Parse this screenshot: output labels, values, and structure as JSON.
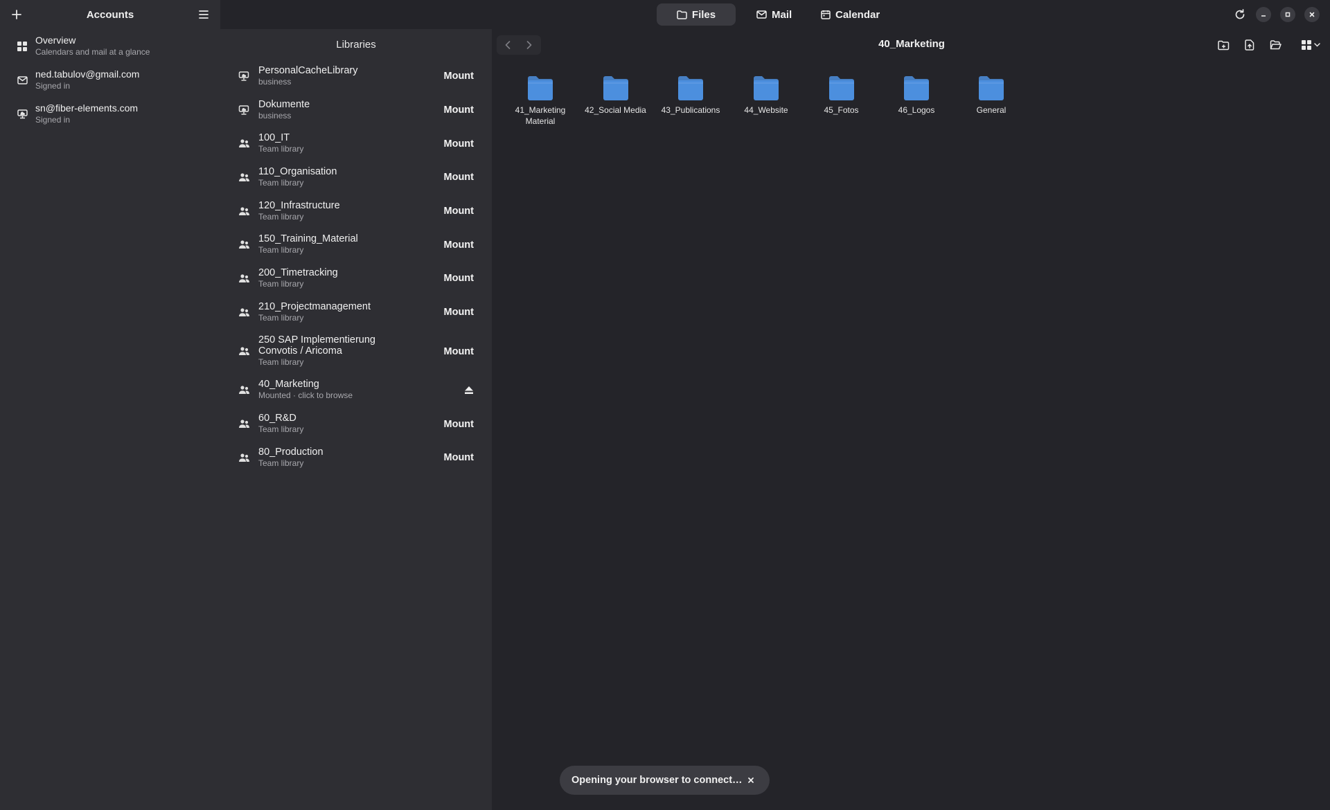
{
  "sidebar": {
    "title": "Accounts",
    "add_icon": "plus-icon",
    "menu_icon": "hamburger-menu-icon",
    "items": [
      {
        "name": "Overview",
        "sub": "Calendars and mail at a glance",
        "icon": "grid-icon"
      },
      {
        "name": "ned.tabulov@gmail.com",
        "sub": "Signed in",
        "icon": "mail-icon"
      },
      {
        "name": "sn@fiber-elements.com",
        "sub": "Signed in",
        "icon": "cloud-drive-icon"
      }
    ]
  },
  "topbar": {
    "tabs": [
      {
        "label": "Files",
        "icon": "folder-icon",
        "active": true
      },
      {
        "label": "Mail",
        "icon": "mail-icon",
        "active": false
      },
      {
        "label": "Calendar",
        "icon": "calendar-icon",
        "active": false
      }
    ],
    "window_controls": [
      "refresh-icon",
      "minimize-icon",
      "maximize-icon",
      "close-icon"
    ]
  },
  "libraries": {
    "title": "Libraries",
    "mount_label": "Mount",
    "items": [
      {
        "name": "PersonalCacheLibrary",
        "sub": "business",
        "type": "personal"
      },
      {
        "name": "Dokumente",
        "sub": "business",
        "type": "personal"
      },
      {
        "name": "100_IT",
        "sub": "Team library",
        "type": "team"
      },
      {
        "name": "110_Organisation",
        "sub": "Team library",
        "type": "team"
      },
      {
        "name": "120_Infrastructure",
        "sub": "Team library",
        "type": "team"
      },
      {
        "name": "150_Training_Material",
        "sub": "Team library",
        "type": "team"
      },
      {
        "name": "200_Timetracking",
        "sub": "Team library",
        "type": "team"
      },
      {
        "name": "210_Projectmanagement",
        "sub": "Team library",
        "type": "team"
      },
      {
        "name": "250 SAP Implementierung Convotis / Aricoma",
        "sub": "Team library",
        "type": "team"
      },
      {
        "name": "40_Marketing",
        "sub": "Mounted · click to browse",
        "type": "team",
        "mounted": true
      },
      {
        "name": "60_R&D",
        "sub": "Team library",
        "type": "team"
      },
      {
        "name": "80_Production",
        "sub": "Team library",
        "type": "team"
      }
    ]
  },
  "browser": {
    "current_folder": "40_Marketing",
    "toolbar_icons": [
      "new-folder-icon",
      "upload-file-icon",
      "open-folder-icon",
      "view-grid-icon"
    ],
    "folders": [
      "41_Marketing Material",
      "42_Social Media",
      "43_Publications",
      "44_Website",
      "45_Fotos",
      "46_Logos",
      "General"
    ],
    "folder_color": "#4c8fde"
  },
  "toast": {
    "text": "Opening your browser to connect…",
    "close_icon": "close-icon"
  }
}
